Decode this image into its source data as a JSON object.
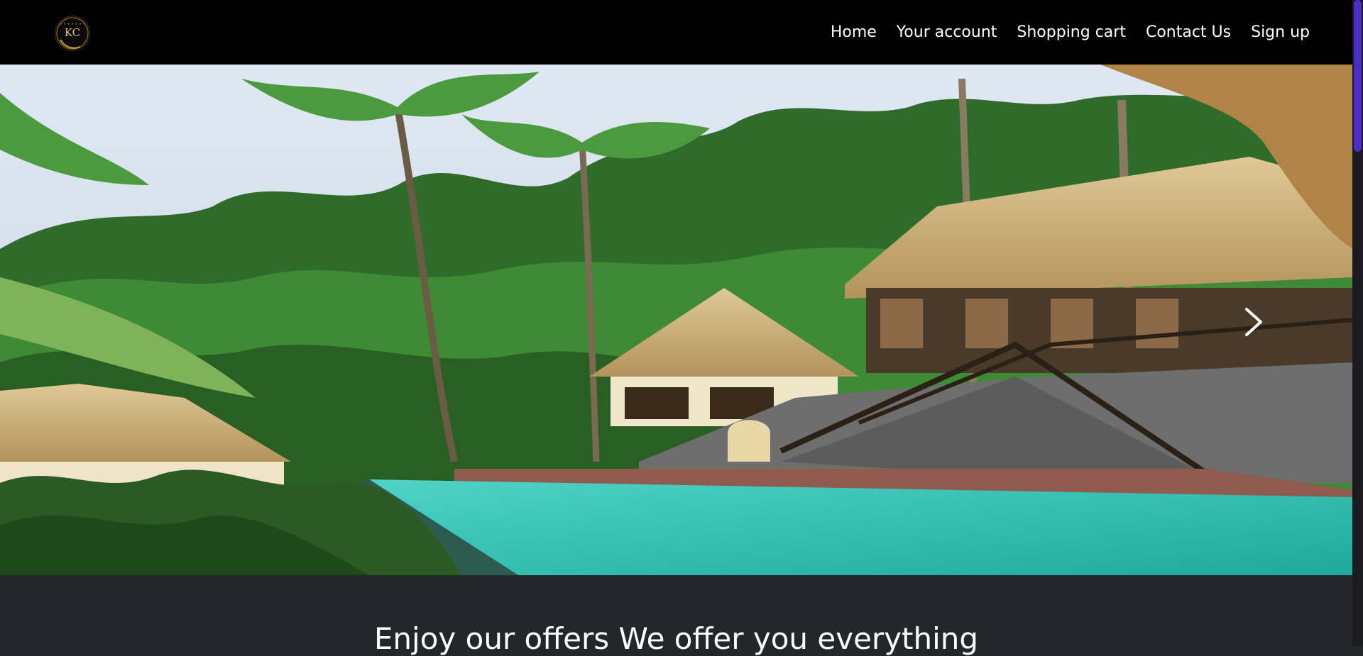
{
  "brand": {
    "logo_text": "KC",
    "logo_ring_text": "• • • • • • •",
    "accent_color": "#b88a2b"
  },
  "nav": {
    "items": [
      "Home",
      "Your account",
      "Shopping cart",
      "Contact Us",
      "Sign up"
    ]
  },
  "hero": {
    "next_icon": "chevron-right-icon"
  },
  "offers": {
    "heading": "Enjoy our offers We offer you everything"
  },
  "colors": {
    "navbar_bg": "#000000",
    "section_bg": "#24262c",
    "scroll_thumb": "#4a2ec9"
  }
}
